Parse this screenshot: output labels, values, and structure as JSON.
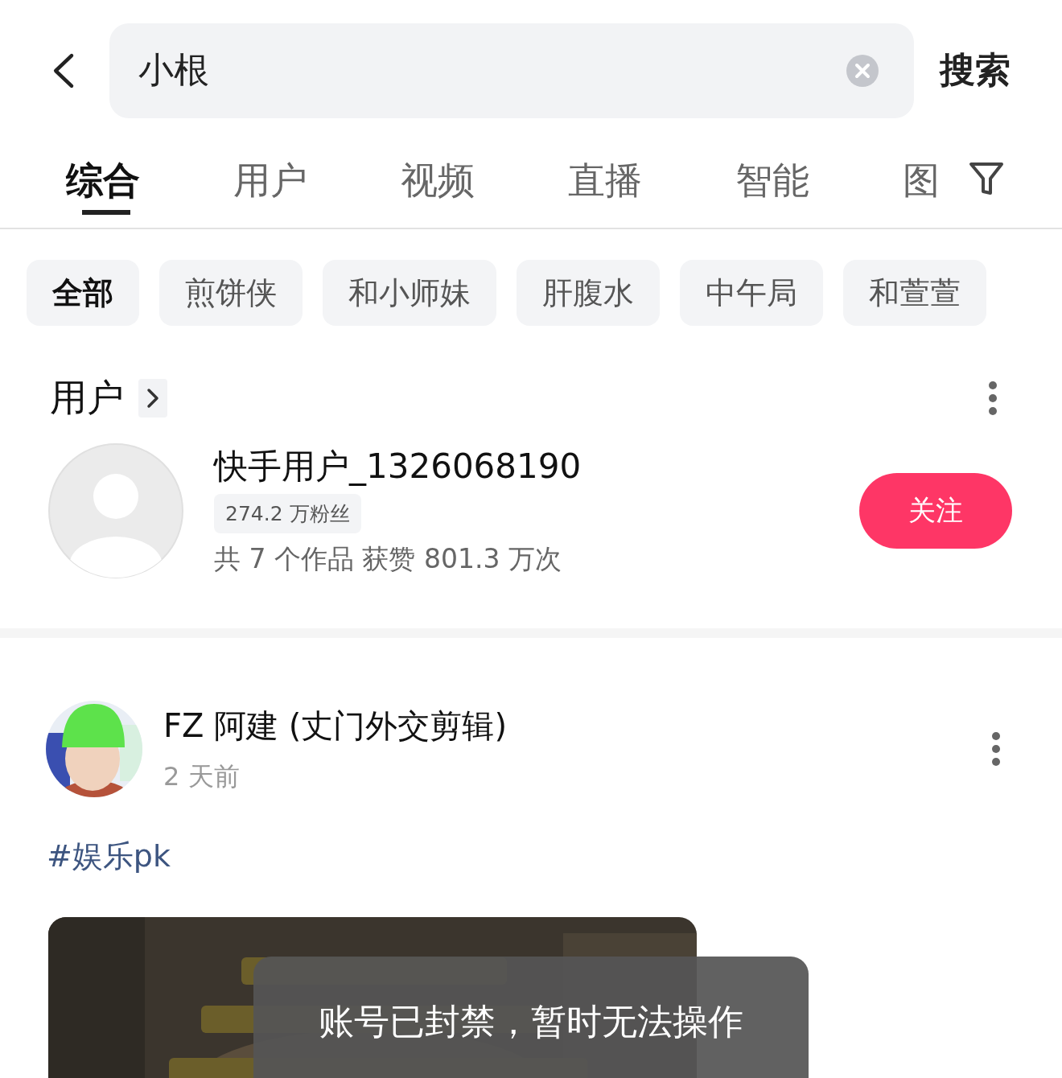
{
  "search": {
    "value": "小根",
    "action": "搜索"
  },
  "tabs": [
    {
      "label": "综合",
      "selected": true
    },
    {
      "label": "用户",
      "selected": false
    },
    {
      "label": "视频",
      "selected": false
    },
    {
      "label": "直播",
      "selected": false
    },
    {
      "label": "智能",
      "selected": false
    },
    {
      "label": "图",
      "selected": false
    }
  ],
  "chips": [
    {
      "label": "全部",
      "selected": true
    },
    {
      "label": "煎饼侠",
      "selected": false
    },
    {
      "label": "和小师妹",
      "selected": false
    },
    {
      "label": "肝腹水",
      "selected": false
    },
    {
      "label": "中午局",
      "selected": false
    },
    {
      "label": "和萱萱",
      "selected": false
    }
  ],
  "user_section": {
    "title": "用户",
    "user": {
      "name": "快手用户_1326068190",
      "followers": "274.2 万粉丝",
      "stats": "共 7 个作品  获赞 801.3 万次",
      "follow_button": "关注"
    }
  },
  "post": {
    "author": "FZ 阿建 (丈门外交剪辑)",
    "time": "2 天前",
    "hashtag": "#娱乐pk"
  },
  "toast": "账号已封禁，暂时无法操作"
}
